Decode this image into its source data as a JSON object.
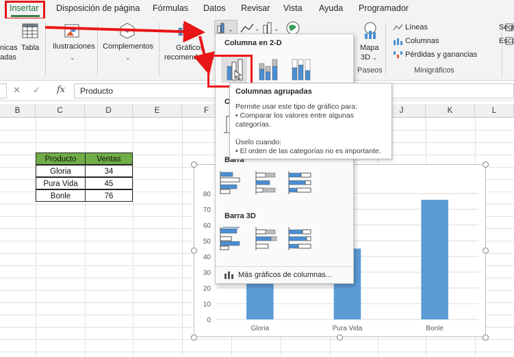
{
  "tabs": [
    "Insertar",
    "Disposición de página",
    "Fórmulas",
    "Datos",
    "Revisar",
    "Vista",
    "Ayuda",
    "Programador"
  ],
  "ribbon": {
    "tablas_partial_1": "nicas",
    "tablas_partial_2": "adas",
    "tabla": "Tabla",
    "ilustraciones": "Ilustraciones",
    "complementos": "Complementos",
    "graficos_recomendados_1": "Gráficos",
    "graficos_recomendados_2": "recomendados",
    "mapa_1": "Mapa",
    "mapa_2": "3D",
    "paseos": "Paseos",
    "lineas": "Líneas",
    "columnas": "Columnas",
    "perdidas": "Pérdidas y ganancias",
    "minigraficos": "Minigráficos",
    "segm_partial": "Segm",
    "esca_partial": "Esca"
  },
  "formula_bar": {
    "cancel": "✕",
    "enter": "✓",
    "fx": "fx",
    "value": "Producto"
  },
  "columns": [
    "B",
    "C",
    "D",
    "E",
    "F",
    "G",
    "H",
    "I",
    "J",
    "K",
    "L"
  ],
  "table": {
    "headers": [
      "Producto",
      "Ventas"
    ],
    "rows": [
      [
        "Gloria",
        "34"
      ],
      [
        "Pura Vida",
        "45"
      ],
      [
        "Bonle",
        "76"
      ]
    ]
  },
  "gallery": {
    "section_2d": "Columna en 2-D",
    "section_3d_col_partial": "C",
    "section_barra_partial": "Barra",
    "section_barra3d": "Barra 3D",
    "more": "Más gráficos de columnas..."
  },
  "tooltip": {
    "title": "Columnas agrupadas",
    "lines": [
      "Permite usar este tipo de gráfico para:",
      "• Comparar los valores entre algunas",
      "categorías.",
      "",
      "Úselo cuando:",
      "• El orden de las categorías no es importante."
    ]
  },
  "chart_data": {
    "type": "bar",
    "categories": [
      "Gloria",
      "Pura Vida",
      "Bonle"
    ],
    "values": [
      34,
      45,
      76
    ],
    "ylim": [
      0,
      80
    ],
    "yticks": [
      "0",
      "10",
      "20",
      "30",
      "40",
      "50",
      "60",
      "70",
      "80"
    ],
    "grid": true,
    "color": "#5b9bd5"
  },
  "colors": {
    "accent": "#2f7d47",
    "highlight": "#e81616",
    "table_header": "#70ad47",
    "bar": "#5b9bd5"
  }
}
